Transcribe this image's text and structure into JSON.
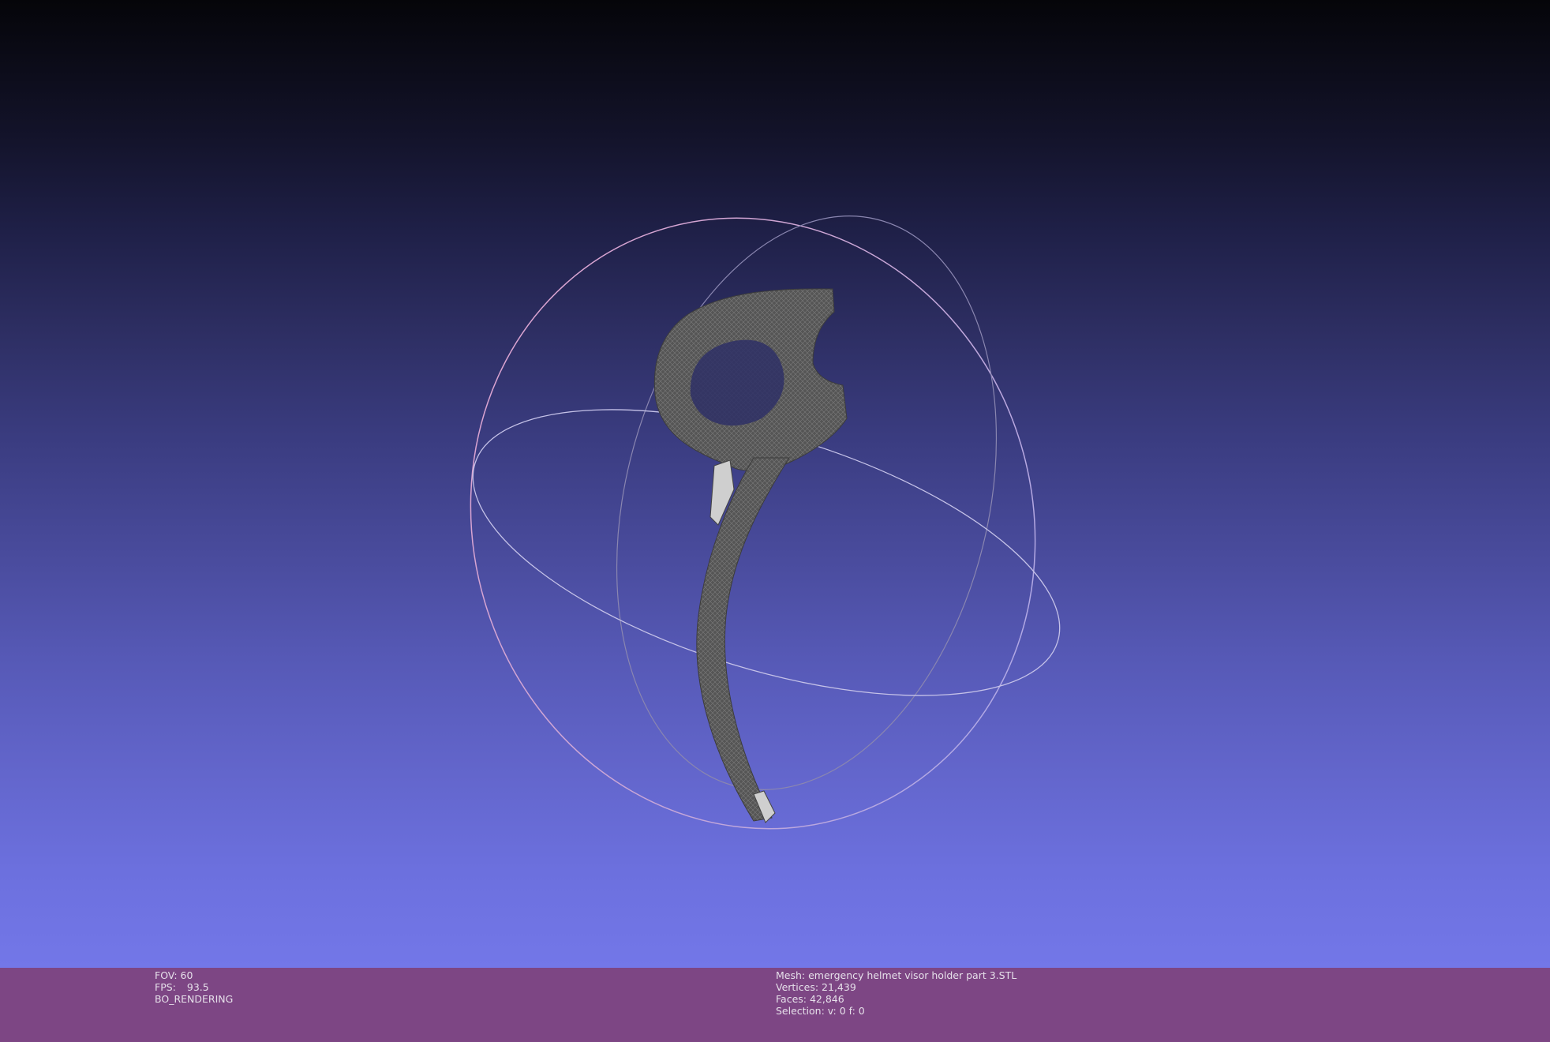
{
  "viewport": {
    "background_top": "#050509",
    "background_bottom": "#7377e8",
    "trackball_colors": [
      "#d99ac6",
      "#b8b3e6",
      "#8c86b3"
    ],
    "mesh_color": "#555555"
  },
  "info_left": {
    "fov": "FOV: 60",
    "fps_label": "FPS:",
    "fps_value": "93.5",
    "render_mode": "BO_RENDERING"
  },
  "info_right": {
    "mesh": "Mesh: emergency helmet visor holder part 3.STL",
    "vertices": "Vertices: 21,439",
    "faces": "Faces: 42,846",
    "selection": "Selection: v: 0 f: 0"
  },
  "infobar_color": "#7d4684"
}
